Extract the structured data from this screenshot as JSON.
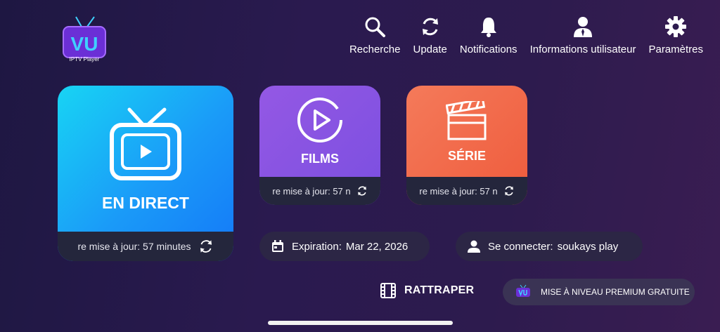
{
  "logo": {
    "text": "VU",
    "subtitle": "IPTV Player"
  },
  "nav": [
    {
      "label": "Recherche",
      "icon": "search-icon"
    },
    {
      "label": "Update",
      "icon": "refresh-icon"
    },
    {
      "label": "Notifications",
      "icon": "bell-icon"
    },
    {
      "label": "Informations utilisateur",
      "icon": "user-icon"
    },
    {
      "label": "Paramètres",
      "icon": "gear-icon"
    }
  ],
  "tiles": {
    "live": {
      "title": "EN DIRECT",
      "footer": "re mise à jour: 57 minutes",
      "icon": "tv-icon"
    },
    "films": {
      "title": "FILMS",
      "footer": "re mise à jour: 57 n",
      "icon": "play-circle-icon"
    },
    "serie": {
      "title": "SÉRIE",
      "footer": "re mise à jour: 57 n",
      "icon": "clapperboard-icon"
    }
  },
  "expiration": {
    "label": "Expiration:",
    "value": "Mar 22, 2026",
    "icon": "calendar-icon"
  },
  "login": {
    "label": "Se connecter:",
    "value": "soukays play",
    "icon": "person-icon"
  },
  "replay": {
    "label": "RATTRAPER",
    "icon": "film-strip-icon"
  },
  "premium": {
    "label": "MISE À NIVEAU PREMIUM GRATUITE",
    "icon": "vu-logo-icon"
  },
  "colors": {
    "live": "#1a9af8",
    "films": "#8652e2",
    "serie": "#f06a48",
    "footer": "#24263c"
  }
}
